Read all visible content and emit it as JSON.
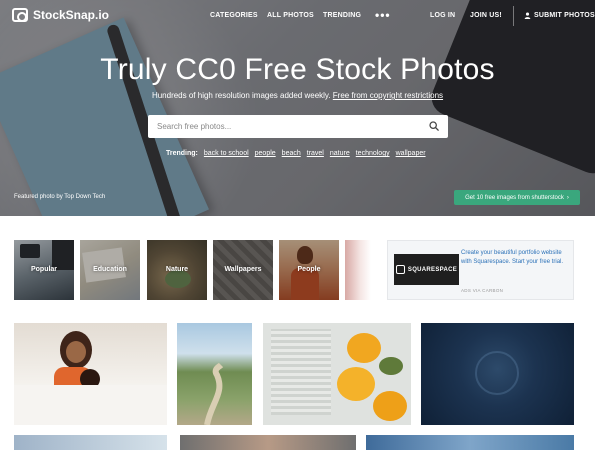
{
  "site": {
    "name": "StockSnap.io"
  },
  "nav": {
    "categories": "CATEGORIES",
    "all_photos": "ALL PHOTOS",
    "trending": "TRENDING",
    "more": "•••",
    "login": "LOG IN",
    "join": "JOIN US!",
    "submit": "SUBMIT PHOTOS"
  },
  "hero": {
    "title": "Truly CC0 Free Stock Photos",
    "subtitle_main": "Hundreds of high resolution images added weekly.",
    "subtitle_link": "Free from copyright restrictions",
    "search_placeholder": "Search free photos...",
    "trending_label": "Trending:",
    "trending_items": [
      "back to school",
      "people",
      "beach",
      "travel",
      "nature",
      "technology",
      "wallpaper"
    ],
    "featured_prefix": "Featured photo by",
    "featured_author": "Top Down Tech",
    "shutterstock_cta": "Get 10 free images from shutterstock",
    "shutterstock_arrow": "›"
  },
  "categories": [
    {
      "label": "Popular",
      "color": "#5b6770"
    },
    {
      "label": "Education",
      "color": "#b8b2a4"
    },
    {
      "label": "Nature",
      "color": "#8a7a60"
    },
    {
      "label": "Wallpapers",
      "color": "#6e6a66"
    },
    {
      "label": "People",
      "color": "#c07a4a"
    }
  ],
  "ad": {
    "brand": "SQUARESPACE",
    "text": "Create your beautiful portfolio website with Squarespace. Start your free trial.",
    "via": "ADS VIA CARBON"
  },
  "colors": {
    "accent_green": "#3aa77d",
    "ad_link_blue": "#2d72b8"
  }
}
